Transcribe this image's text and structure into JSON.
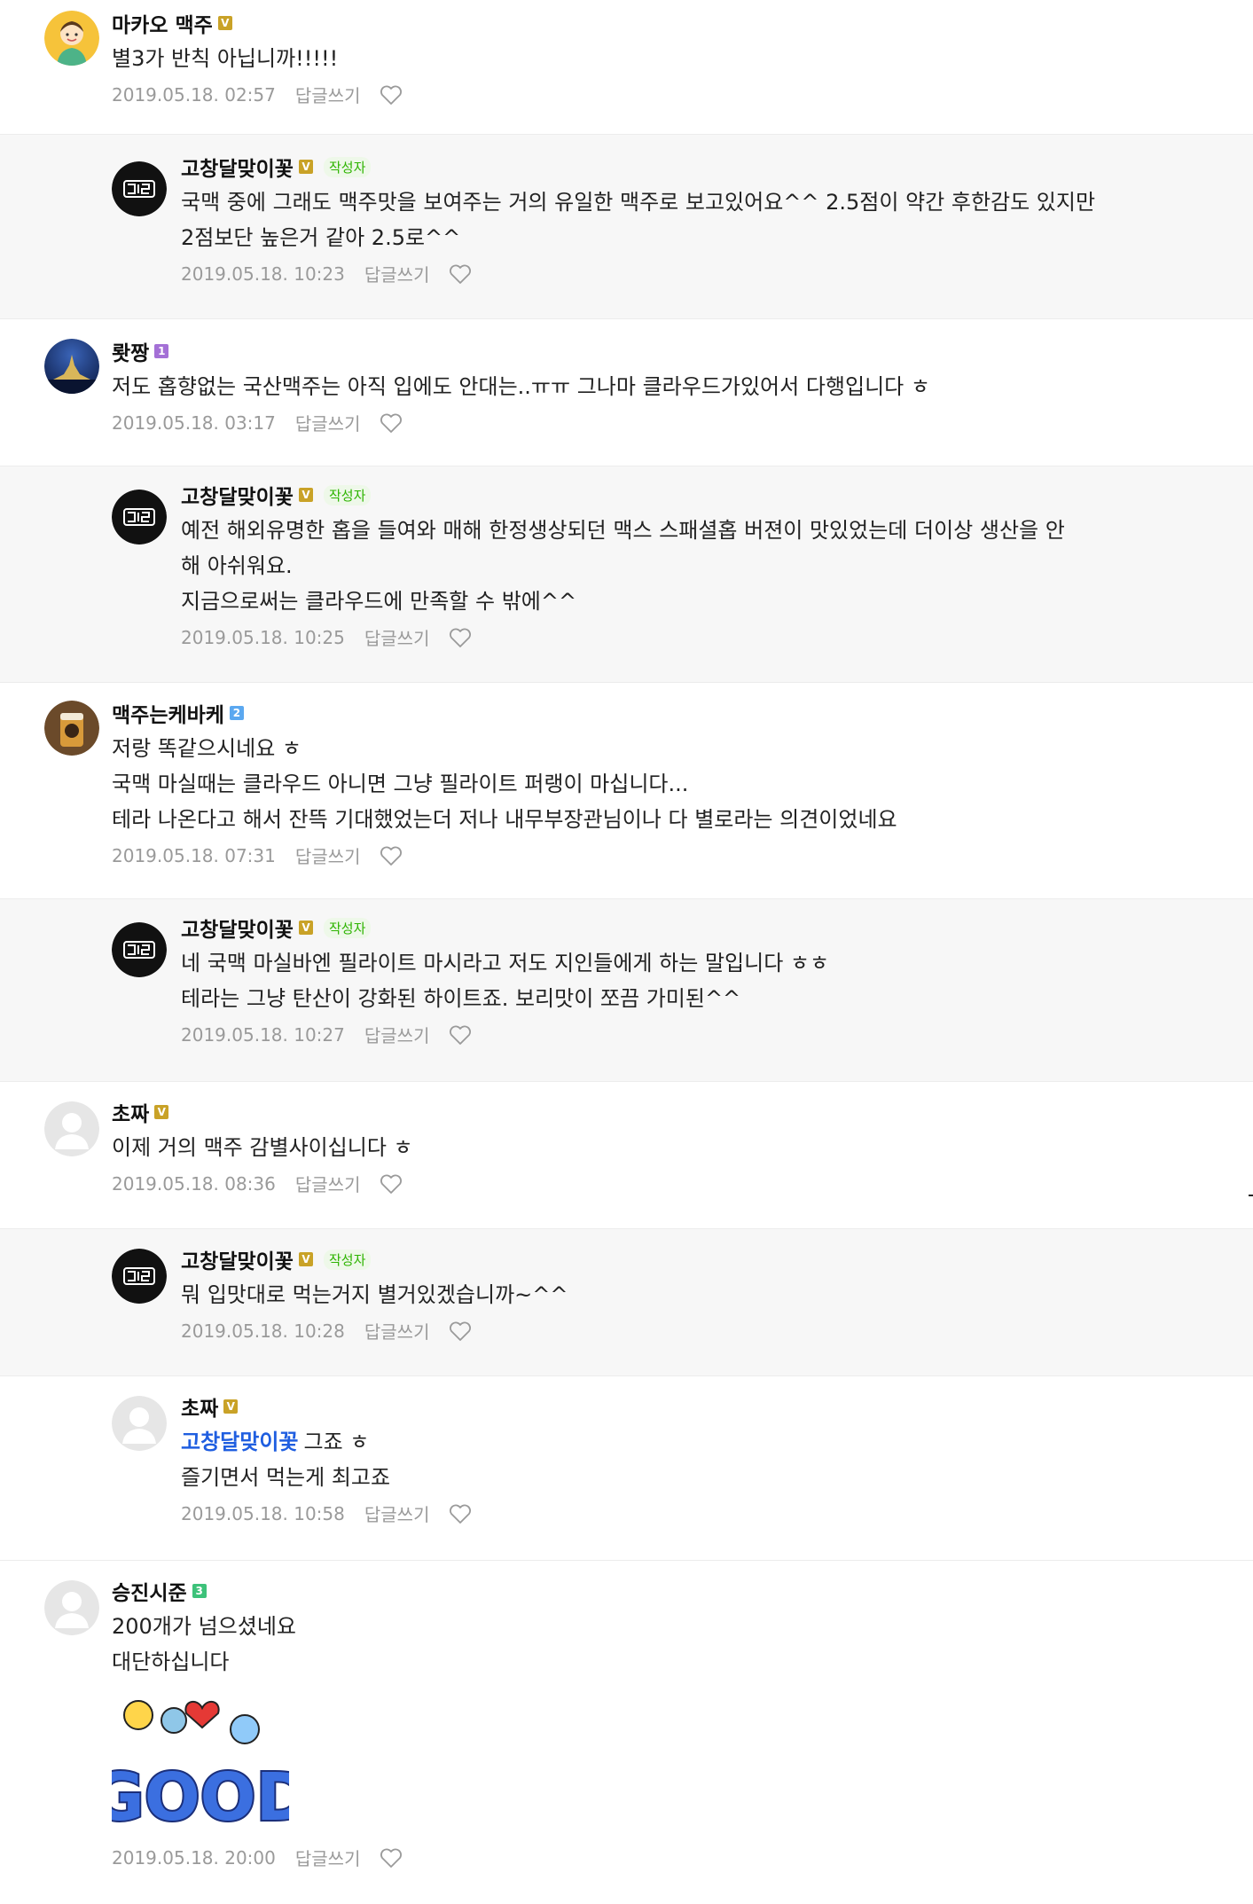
{
  "ui": {
    "reply_label": "답글쓰기",
    "author_tag": "작성자",
    "badge_colors": {
      "V": "#c9a227",
      "1": "#a470d6",
      "2": "#5ba8f0",
      "3": "#3dc27a"
    },
    "accent": "#2db400",
    "mention_color": "#1f5ee0"
  },
  "comments": [
    {
      "nick": "마카오 맥주",
      "badge": "V",
      "text": "별3가 반칙 아닙니까!!!!!",
      "date": "2019.05.18. 02:57",
      "avatar": "cartoon-boy"
    },
    {
      "nick": "고창달맞이꽃",
      "badge": "V",
      "author": true,
      "text": "국맥 중에 그래도 맥주맛을 보여주는 거의 유일한 맥주로 보고있어요^^ 2.5점이 약간 후한감도 있지만\n2점보단 높은거 같아 2.5로^^",
      "date": "2019.05.18. 10:23",
      "avatar": "logo"
    },
    {
      "nick": "뢋짱",
      "badge": "1",
      "text": "저도 홉향없는 국산맥주는 아직 입에도 안대는..ㅠㅠ 그나마 클라우드가있어서 다행입니다 ㅎ",
      "date": "2019.05.18. 03:17",
      "avatar": "night-castle"
    },
    {
      "nick": "고창달맞이꽃",
      "badge": "V",
      "author": true,
      "text": "예전 해외유명한 홉을 들여와 매해 한정생상되던 맥스 스패셜홉 버젼이 맛있었는데 더이상 생산을 안\n해 아쉬워요.\n지금으로써는 클라우드에 만족할 수 밖에^^",
      "date": "2019.05.18. 10:25",
      "avatar": "logo"
    },
    {
      "nick": "맥주는케바케",
      "badge": "2",
      "text": "저랑 똑같으시네요 ㅎ\n국맥 마실때는 클라우드 아니면 그냥 필라이트 퍼랭이 마십니다...\n테라 나온다고 해서 잔뜩 기대했었는더 저나 내무부장관님이나 다 별로라는 의견이었네요",
      "date": "2019.05.18. 07:31",
      "avatar": "beer-glass"
    },
    {
      "nick": "고창달맞이꽃",
      "badge": "V",
      "author": true,
      "text": "네 국맥 마실바엔 필라이트 마시라고 저도 지인들에게 하는 말입니다 ㅎㅎ\n테라는 그냥 탄산이 강화된 하이트죠. 보리맛이 쪼끔 가미된^^",
      "date": "2019.05.18. 10:27",
      "avatar": "logo"
    },
    {
      "nick": "초짜",
      "badge": "V",
      "text": "이제 거의 맥주 감별사이십니다 ㅎ",
      "date": "2019.05.18. 08:36",
      "avatar": "default"
    },
    {
      "nick": "고창달맞이꽃",
      "badge": "V",
      "author": true,
      "text": "뭐 입맛대로 먹는거지 별거있겠습니까~^^",
      "date": "2019.05.18. 10:28",
      "avatar": "logo"
    },
    {
      "nick": "초짜",
      "badge": "V",
      "mention": "고창달맞이꽃",
      "text": "그죠 ㅎ\n즐기면서 먹는게 최고죠",
      "date": "2019.05.18. 10:58",
      "avatar": "default"
    },
    {
      "nick": "승진시준",
      "badge": "3",
      "text": "200개가 넘으셨네요\n대단하십니다",
      "date": "2019.05.18. 20:00",
      "avatar": "default",
      "sticker_text": "GOOD"
    }
  ]
}
